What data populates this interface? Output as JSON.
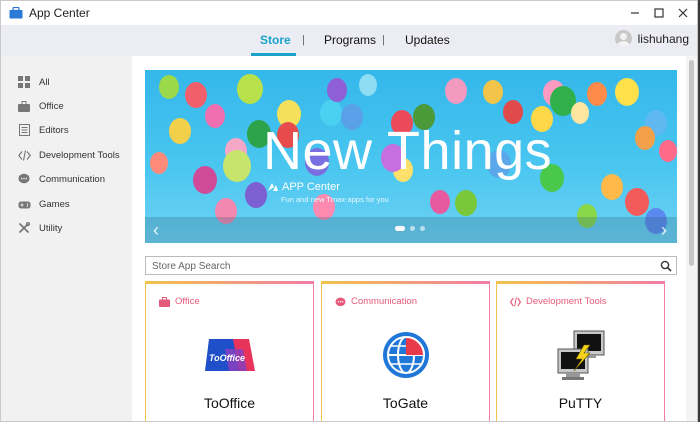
{
  "window": {
    "title": "App Center"
  },
  "nav": {
    "tabs": [
      {
        "label": "Store",
        "active": true
      },
      {
        "label": "Programs",
        "active": false
      },
      {
        "label": "Updates",
        "active": false
      }
    ],
    "separator": "|",
    "username": "lishuhang"
  },
  "sidebar": {
    "items": [
      {
        "label": "All",
        "icon": "grid-icon"
      },
      {
        "label": "Office",
        "icon": "briefcase-icon"
      },
      {
        "label": "Editors",
        "icon": "document-icon"
      },
      {
        "label": "Development Tools",
        "icon": "code-icon"
      },
      {
        "label": "Communication",
        "icon": "chat-icon"
      },
      {
        "label": "Games",
        "icon": "gamepad-icon"
      },
      {
        "label": "Utility",
        "icon": "tools-icon"
      }
    ]
  },
  "banner": {
    "title": "New Things",
    "brand": "APP Center",
    "subtitle": "Fun and new Tmax-apps for you",
    "prev": "‹",
    "next": "›",
    "slides": 3,
    "active_slide": 1
  },
  "search": {
    "placeholder": "Store App Search"
  },
  "cards": [
    {
      "category": "Office",
      "name": "ToOffice",
      "logo_text": "ToOffice"
    },
    {
      "category": "Communication",
      "name": "ToGate"
    },
    {
      "category": "Development Tools",
      "name": "PuTTY"
    }
  ],
  "colors": {
    "accent": "#1aa3c8",
    "category_text": "#e55a7b",
    "banner_sky": "#3bbbee"
  }
}
